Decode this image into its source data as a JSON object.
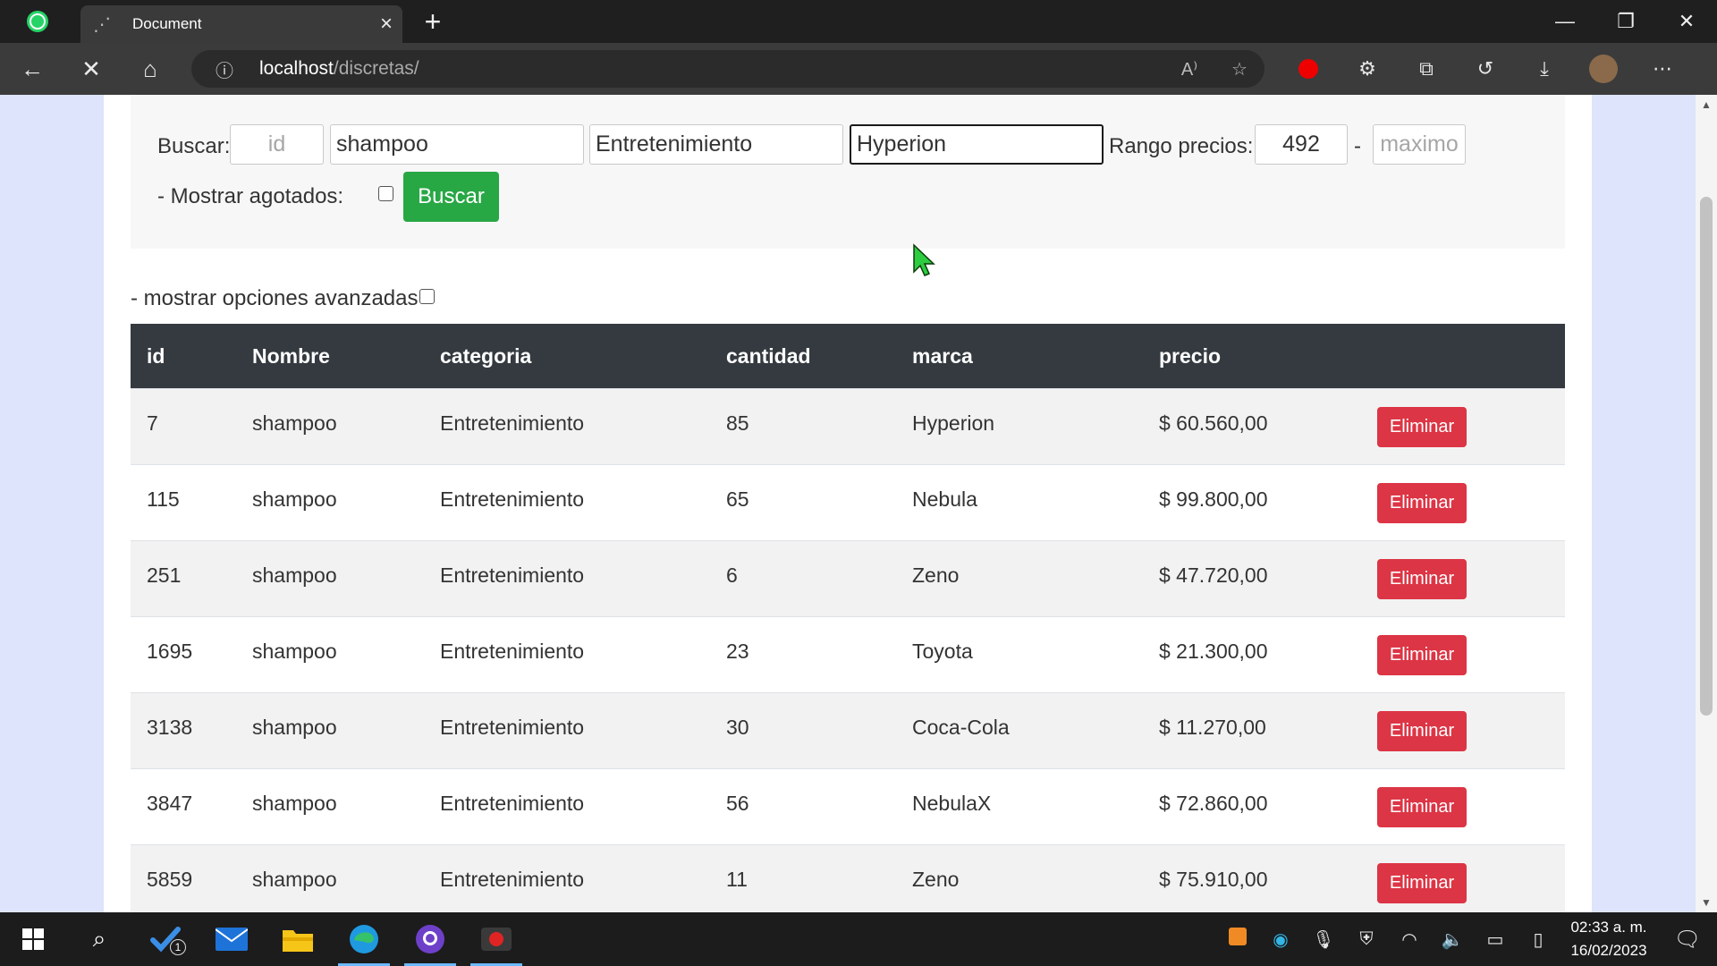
{
  "browser": {
    "tab_title": "Document",
    "url_host": "localhost",
    "url_path": "/discretas/"
  },
  "search": {
    "label": "Buscar:",
    "id_placeholder": "id",
    "nombre_value": "shampoo",
    "categoria_value": "Entretenimiento",
    "marca_value": "Hyperion",
    "rango_label": "Rango precios:",
    "min_value": "492",
    "dash": "-",
    "max_placeholder": "maximo",
    "agotados_label": "- Mostrar agotados:",
    "buscar_label": "Buscar"
  },
  "advanced_label": "- mostrar opciones avanzadas",
  "table": {
    "headers": [
      "id",
      "Nombre",
      "categoria",
      "cantidad",
      "marca",
      "precio"
    ],
    "delete_label": "Eliminar",
    "rows": [
      {
        "id": "7",
        "nombre": "shampoo",
        "categoria": "Entretenimiento",
        "cantidad": "85",
        "marca": "Hyperion",
        "precio": "$ 60.560,00"
      },
      {
        "id": "115",
        "nombre": "shampoo",
        "categoria": "Entretenimiento",
        "cantidad": "65",
        "marca": "Nebula",
        "precio": "$ 99.800,00"
      },
      {
        "id": "251",
        "nombre": "shampoo",
        "categoria": "Entretenimiento",
        "cantidad": "6",
        "marca": "Zeno",
        "precio": "$ 47.720,00"
      },
      {
        "id": "1695",
        "nombre": "shampoo",
        "categoria": "Entretenimiento",
        "cantidad": "23",
        "marca": "Toyota",
        "precio": "$ 21.300,00"
      },
      {
        "id": "3138",
        "nombre": "shampoo",
        "categoria": "Entretenimiento",
        "cantidad": "30",
        "marca": "Coca-Cola",
        "precio": "$ 11.270,00"
      },
      {
        "id": "3847",
        "nombre": "shampoo",
        "categoria": "Entretenimiento",
        "cantidad": "56",
        "marca": "NebulaX",
        "precio": "$ 72.860,00"
      },
      {
        "id": "5859",
        "nombre": "shampoo",
        "categoria": "Entretenimiento",
        "cantidad": "11",
        "marca": "Zeno",
        "precio": "$ 75.910,00"
      }
    ]
  },
  "taskbar": {
    "todo_badge": "1",
    "time": "02:33 a. m.",
    "date": "16/02/2023"
  },
  "colors": {
    "success": "#28a745",
    "danger": "#dc3545",
    "table_header": "#343a40"
  }
}
